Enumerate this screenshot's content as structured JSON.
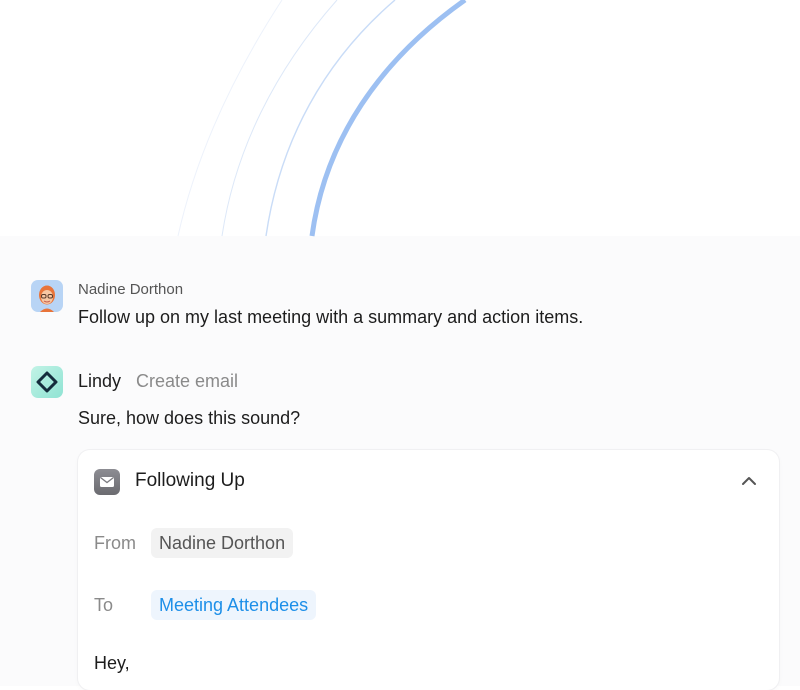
{
  "conversation": {
    "user_message": {
      "sender": "Nadine Dorthon",
      "text": "Follow up on my last meeting with a summary and action items."
    },
    "assistant_message": {
      "sender": "Lindy",
      "action": "Create email",
      "text": "Sure, how does this sound?"
    }
  },
  "email_card": {
    "title": "Following Up",
    "from_label": "From",
    "from_value": "Nadine Dorthon",
    "to_label": "To",
    "to_value": "Meeting Attendees",
    "body_start": "Hey,"
  },
  "icons": {
    "user_avatar": "avatar",
    "assistant_logo": "lindy-logo-icon",
    "mail": "mail-icon",
    "collapse": "chevron-up-icon"
  },
  "colors": {
    "arc_accent": "#9dc0f2",
    "to_chip_text": "#1d8fe8",
    "to_chip_bg": "#eef5fd",
    "logo_bg": "#a7ecdd"
  }
}
